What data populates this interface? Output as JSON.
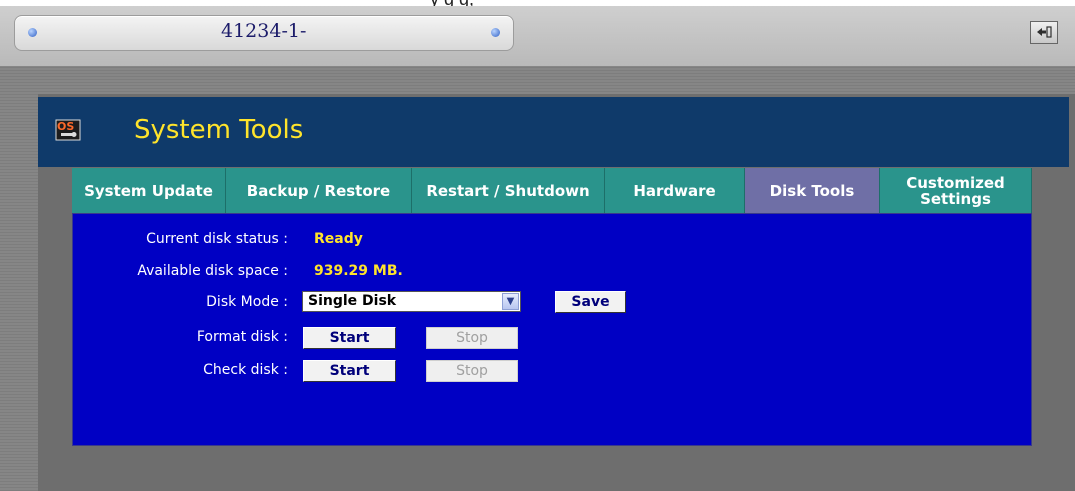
{
  "top_caption": "y                                            g  g,",
  "device": {
    "name": "41234-1-",
    "logout_icon": "logout-icon"
  },
  "banner": {
    "icon": "system-tools-icon",
    "icon_text": "OS",
    "title": "System Tools"
  },
  "tabs": [
    {
      "label": "System Update"
    },
    {
      "label": "Backup / Restore"
    },
    {
      "label": "Restart / Shutdown"
    },
    {
      "label": "Hardware"
    },
    {
      "label": "Disk Tools",
      "active": true
    },
    {
      "label": "Customized Settings"
    }
  ],
  "disk_tools": {
    "status_label": "Current disk status :",
    "status_value": "Ready",
    "space_label": "Available disk space :",
    "space_value": "939.29 MB.",
    "mode_label": "Disk Mode :",
    "mode_value": "Single Disk",
    "save_label": "Save",
    "format_label": "Format disk :",
    "check_label": "Check disk :",
    "start_label": "Start",
    "stop_label": "Stop"
  },
  "colors": {
    "accent_yellow": "#ffe42b",
    "tab_teal": "#2a948c",
    "tab_active": "#6f6fa6",
    "panel_blue": "#0000c4",
    "banner_navy": "#0f3a6a"
  }
}
